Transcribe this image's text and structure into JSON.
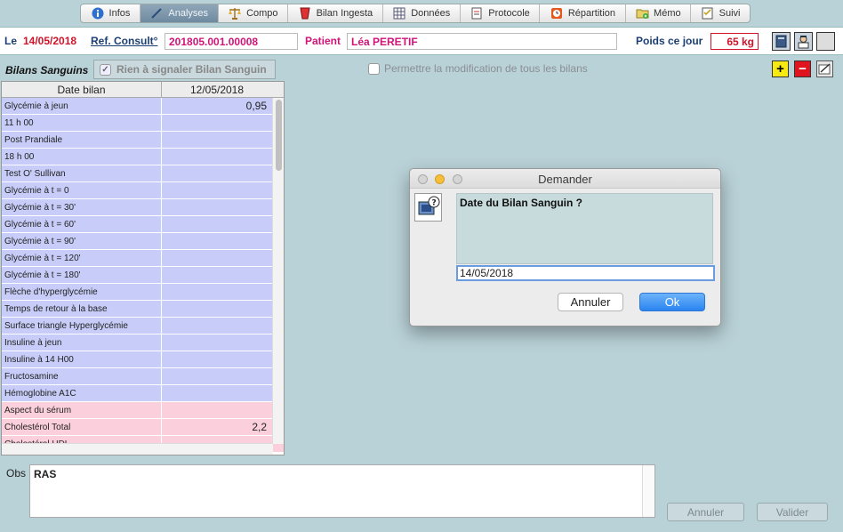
{
  "tabs": [
    {
      "label": "Infos",
      "icon": "info-icon",
      "active": false
    },
    {
      "label": "Analyses",
      "icon": "pen-icon",
      "active": true
    },
    {
      "label": "Compo",
      "icon": "scale-icon",
      "active": false
    },
    {
      "label": "Bilan Ingesta",
      "icon": "cup-icon",
      "active": false
    },
    {
      "label": "Données",
      "icon": "grid-icon",
      "active": false
    },
    {
      "label": "Protocole",
      "icon": "document-icon",
      "active": false
    },
    {
      "label": "Répartition",
      "icon": "clock-icon",
      "active": false
    },
    {
      "label": "Mémo",
      "icon": "folder-add-icon",
      "active": false
    },
    {
      "label": "Suivi",
      "icon": "checklist-icon",
      "active": false
    }
  ],
  "header": {
    "date_label": "Le",
    "date_value": "14/05/2018",
    "ref_label": "Ref. Consult°",
    "ref_value": "201805.001.00008",
    "patient_label": "Patient",
    "patient_value": "Léa PERETIF",
    "weight_label": "Poids ce jour",
    "weight_value": "65 kg"
  },
  "bilans": {
    "title": "Bilans Sanguins",
    "rien_label": "Rien à signaler Bilan Sanguin",
    "permettre_label": "Permettre la modification de tous les bilans"
  },
  "table": {
    "headers": [
      "Date bilan",
      "12/05/2018"
    ],
    "rows": [
      {
        "label": "Glycémie à jeun",
        "value": "0,95",
        "color": "blue"
      },
      {
        "label": "11 h 00",
        "value": "",
        "color": "blue"
      },
      {
        "label": "Post Prandiale",
        "value": "",
        "color": "blue"
      },
      {
        "label": "18 h 00",
        "value": "",
        "color": "blue"
      },
      {
        "label": "Test O' Sullivan",
        "value": "",
        "color": "blue"
      },
      {
        "label": "Glycémie à t = 0",
        "value": "",
        "color": "blue"
      },
      {
        "label": "Glycémie à t = 30'",
        "value": "",
        "color": "blue"
      },
      {
        "label": "Glycémie à t = 60'",
        "value": "",
        "color": "blue"
      },
      {
        "label": "Glycémie à t = 90'",
        "value": "",
        "color": "blue"
      },
      {
        "label": "Glycémie à t = 120'",
        "value": "",
        "color": "blue"
      },
      {
        "label": "Glycémie à t = 180'",
        "value": "",
        "color": "blue"
      },
      {
        "label": "Flèche d'hyperglycémie",
        "value": "",
        "color": "blue"
      },
      {
        "label": "Temps de retour à la base",
        "value": "",
        "color": "blue"
      },
      {
        "label": "Surface triangle Hyperglycémie",
        "value": "",
        "color": "blue"
      },
      {
        "label": "Insuline à jeun",
        "value": "",
        "color": "blue"
      },
      {
        "label": "Insuline à 14 H00",
        "value": "",
        "color": "blue"
      },
      {
        "label": "Fructosamine",
        "value": "",
        "color": "blue"
      },
      {
        "label": "Hémoglobine A1C",
        "value": "",
        "color": "blue"
      },
      {
        "label": "Aspect du sérum",
        "value": "",
        "color": "pink"
      },
      {
        "label": "Cholestérol Total",
        "value": "2,2",
        "color": "pink"
      },
      {
        "label": "Cholestérol HDL",
        "value": "",
        "color": "pink"
      }
    ]
  },
  "obs": {
    "label": "Obs",
    "value": "RAS"
  },
  "bottom": {
    "cancel_label": "Annuler",
    "validate_label": "Valider"
  },
  "dialog": {
    "title": "Demander",
    "message": "Date du Bilan Sanguin ?",
    "input_value": "14/05/2018",
    "cancel_label": "Annuler",
    "ok_label": "Ok"
  },
  "colors": {
    "background": "#b9d2d8",
    "row_blue": "#c7cdf8",
    "row_pink": "#fbd0dc",
    "accent_red": "#d0132a",
    "accent_magenta": "#d01478",
    "ok_blue": "#2a84f0"
  }
}
